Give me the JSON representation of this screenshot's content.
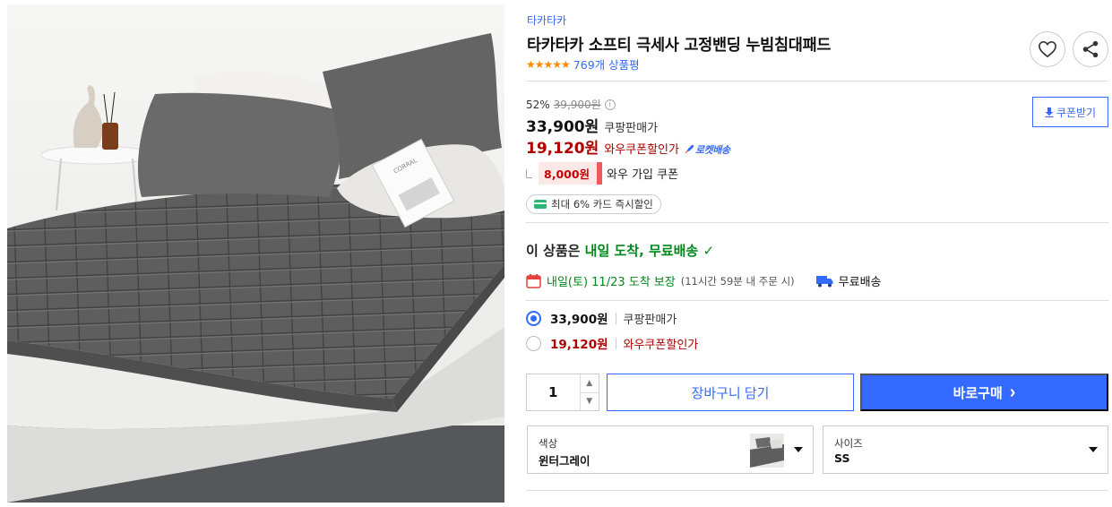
{
  "product": {
    "brand": "타카타카",
    "title": "타카타카 소프티 극세사 고정밴딩 누빔침대패드",
    "rating_stars": "★★★★★",
    "review_count": "769개 상품평",
    "image_alt": "누빔침대패드 제품 사진",
    "image_book_text": "CORRAL"
  },
  "actions": {
    "wishlist_icon": "heart-icon",
    "share_icon": "share-icon",
    "coupon_button": "쿠폰받기"
  },
  "pricing": {
    "discount_rate": "52%",
    "original_price": "39,900원",
    "sale_price": "33,900원",
    "sale_label": "쿠팡판매가",
    "wow_price": "19,120원",
    "wow_label": "와우쿠폰할인가",
    "rocket_badge": "로켓배송",
    "coupon_amount": "8,000원",
    "coupon_text": "와우 가입 쿠폰",
    "card_discount": "최대 6% 카드 즉시할인"
  },
  "delivery": {
    "headline_prefix": "이 상품은 ",
    "headline_highlight": "내일 도착, 무료배송",
    "headline_check": "✓",
    "arrival": "내일(토) 11/23 도착 보장",
    "cutoff": "(11시간 59분 내 주문 시)",
    "shipping": "무료배송"
  },
  "price_options": [
    {
      "price": "33,900원",
      "label": "쿠팡판매가",
      "selected": true,
      "color": "#111111"
    },
    {
      "price": "19,120원",
      "label": "와우쿠폰할인가",
      "selected": false,
      "color": "#ae0000"
    }
  ],
  "purchase": {
    "quantity": "1",
    "up_arrow": "▲",
    "down_arrow": "▼",
    "cart_button": "장바구니 담기",
    "buy_button": "바로구매",
    "buy_chevron": "›"
  },
  "selectors": {
    "color_label": "색상",
    "color_value": "윈터그레이",
    "size_label": "사이즈",
    "size_value": "SS"
  },
  "colors": {
    "accent_blue": "#346aff",
    "wow_red": "#ae0000",
    "delivery_green": "#00891a",
    "rating_orange": "#ff8a00"
  }
}
